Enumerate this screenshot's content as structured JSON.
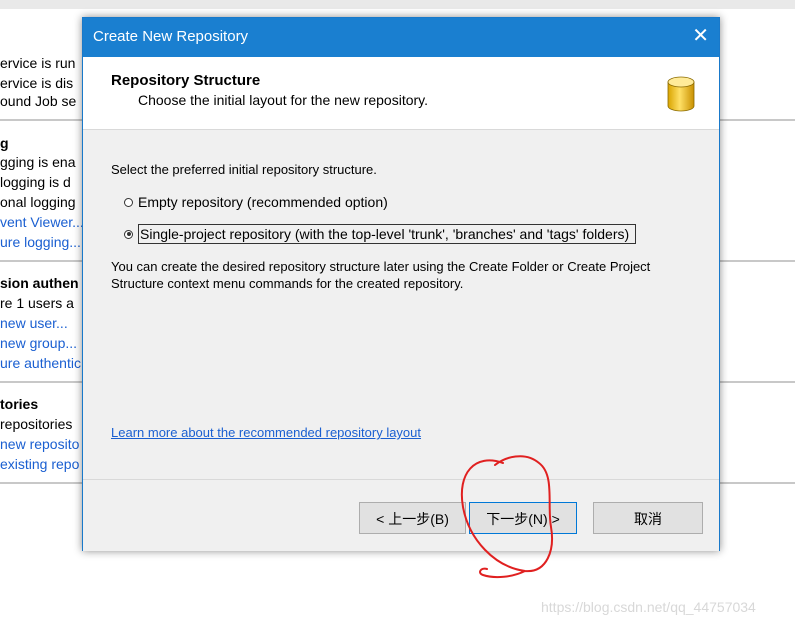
{
  "background": {
    "sections": [
      [
        "ervice is run",
        "ervice is dis",
        "ound Job se"
      ],
      [
        "g",
        "gging is ena",
        " logging is d",
        "onal logging",
        "vent Viewer...",
        "ure logging..."
      ],
      [
        "sion authen",
        "re 1 users a",
        "new user...",
        "new group...",
        "ure authentic"
      ],
      [
        "tories",
        "repositories",
        "new reposito",
        "existing repo"
      ]
    ]
  },
  "dialog": {
    "title": "Create New Repository",
    "close_symbol": "✕",
    "header": {
      "title": "Repository Structure",
      "subtitle": "Choose the initial layout for the new repository.",
      "icon": "database-icon"
    },
    "prompt": "Select the preferred initial repository structure.",
    "options": [
      {
        "label": "Empty repository (recommended option)",
        "checked": false
      },
      {
        "label": "Single-project repository (with the top-level 'trunk', 'branches' and 'tags' folders)",
        "checked": true
      }
    ],
    "info_line1": "You can create the desired repository structure later using the Create Folder or Create Project",
    "info_line2": "Structure context menu commands for the created repository.",
    "learn_more": "Learn more about the recommended repository layout",
    "buttons": {
      "back": "< 上一步(B)",
      "next": "下一步(N) >",
      "cancel": "取消"
    }
  },
  "watermark": "https://blog.csdn.net/qq_44757034",
  "colors": {
    "titlebar": "#1a7fd0",
    "link": "#1a5fd1",
    "annotation": "#e02020"
  }
}
